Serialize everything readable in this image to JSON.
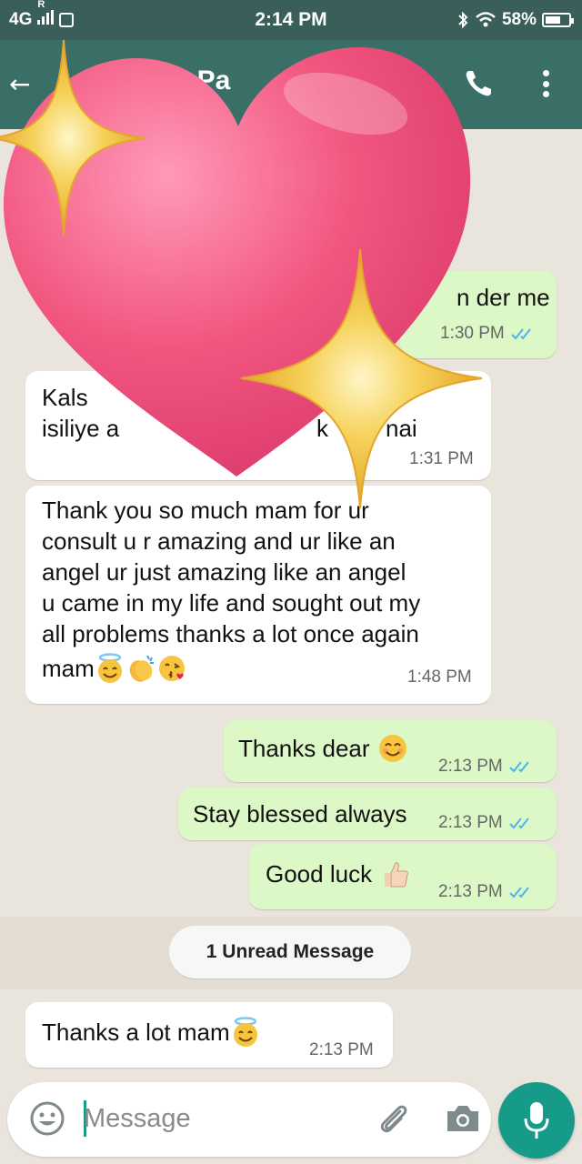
{
  "status_bar": {
    "network": "4G",
    "roaming": "R",
    "time": "2:14 PM",
    "battery": "58%",
    "battery_level": 0.58
  },
  "header": {
    "contact_name_visible": "n Pa"
  },
  "messages": [
    {
      "direction": "out",
      "text": "n der me",
      "time": "1:30 PM",
      "status": "read"
    },
    {
      "direction": "in",
      "line1": "Kals",
      "line2a": "isiliye a",
      "line2b": "k",
      "line2c": "nai",
      "time": "1:31 PM"
    },
    {
      "direction": "in",
      "lines": [
        "Thank you so much mam for ur",
        "consult u r amazing and ur like an",
        "angel ur just amazing like an angel",
        "u came in my life and sought out my",
        "all problems thanks a lot once again",
        "mam"
      ],
      "emojis": [
        "smiling-face-with-halo",
        "clapping-hands",
        "face-blowing-kiss"
      ],
      "time": "1:48 PM"
    },
    {
      "direction": "out",
      "text": "Thanks dear",
      "emojis": [
        "smiling-face-with-smiling-eyes"
      ],
      "time": "2:13 PM",
      "status": "read"
    },
    {
      "direction": "out",
      "text": "Stay blessed always",
      "time": "2:13 PM",
      "status": "read"
    },
    {
      "direction": "out",
      "text": "Good luck",
      "emojis": [
        "thumbs-up"
      ],
      "time": "2:13 PM",
      "status": "read"
    },
    {
      "direction": "in",
      "text": "Thanks a lot mam",
      "emojis": [
        "smiling-face-with-halo"
      ],
      "time": "2:13 PM"
    }
  ],
  "unread_banner": "1 Unread Message",
  "composer": {
    "placeholder": "Message"
  },
  "sticker": {
    "name": "sparkling-heart",
    "colors": {
      "heart": "#f0507a",
      "sparkle": "#f4c430"
    }
  },
  "colors": {
    "status_bar": "#3a5f5b",
    "app_bar": "#3a6f68",
    "outgoing_bubble": "#dcf8c6",
    "incoming_bubble": "#ffffff",
    "read_ticks": "#4fb3e8",
    "mic_button": "#169b89"
  }
}
